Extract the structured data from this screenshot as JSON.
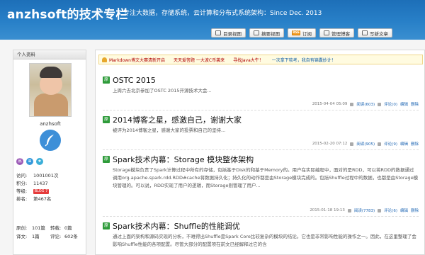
{
  "header": {
    "title": "anzhsoft的技术专栏",
    "subtitle": "专注大数据，存储系统，云计算和分布式系统架构：Since Dec. 2013"
  },
  "toolbar": {
    "buttons": [
      {
        "label": "目录视图",
        "icon": "list-icon"
      },
      {
        "label": "摘要视图",
        "icon": "summary-icon"
      },
      {
        "label": "订阅",
        "icon": "rss-icon",
        "badge": "RSS"
      },
      {
        "label": "管理博客",
        "icon": "manage-icon"
      },
      {
        "label": "写新文章",
        "icon": "write-icon"
      }
    ]
  },
  "sidebar": {
    "heading": "个人资料",
    "username": "anzhsoft",
    "badges": [
      {
        "color": "#9b59b6",
        "label": "三"
      },
      {
        "color": "#3498db",
        "label": "≡"
      },
      {
        "color": "#3aaed8",
        "label": "★"
      }
    ],
    "stats": {
      "visits_label": "访问:",
      "visits": "1001001次",
      "points_label": "积分:",
      "points": "11437",
      "level_label": "等级:",
      "level": "BLOG 7",
      "rank_label": "排名:",
      "rank": "第467名",
      "original_label": "原创:",
      "original": "101篇",
      "reprint_label": "转载:",
      "reprint": "0篇",
      "translated_label": "译文:",
      "translated": "1篇",
      "comments_label": "评论:",
      "comments": "602条"
    }
  },
  "notice": {
    "items": [
      "Markdown博文大赛清新开启",
      "天天爱答题 一大波C币袭来",
      "寻找Java大牛！",
      "一次拿下软考，我自有锦囊妙计！"
    ]
  },
  "posts": [
    {
      "badge": "原",
      "title": "OSTC 2015",
      "summary": "上周六去北京参加了OSTC 2015开源技术大会...",
      "date": "2015-04-04 05:09",
      "reads": "阅读(603)",
      "comments": "评论(0)",
      "edit": "编辑",
      "delete": "删除"
    },
    {
      "badge": "原",
      "title": "2014博客之星，感激自己，谢谢大家",
      "summary": "被评为2014博客之星，感谢大家的投票和自己的坚持...",
      "date": "2015-02-20 07:12",
      "reads": "阅读(905)",
      "comments": "评论(9)",
      "edit": "编辑",
      "delete": "删除"
    },
    {
      "badge": "原",
      "title": "Spark技术内幕：Storage 模块整体架构",
      "summary": "Storage模块负责了Spark计算过程中所有的存储，包括基于Disk的和基于Memory的。用户在实际编程中，面对的是RDD，可以将RDD的数据通过调用org.apache.spark.rdd.RDD#cache将数据持久化；持久化的动作都是由Storage模块完成的。包括Shuffle过程中的数据，也都是由Storage模块管理的。可以说，RDD实现了用户的逻辑，而Storage则管理了用户...",
      "date": "2015-01-18 19:13",
      "reads": "阅读(7783)",
      "comments": "评论(6)",
      "edit": "编辑",
      "delete": "删除"
    },
    {
      "badge": "原",
      "title": "Spark技术内幕：Shuffle的性能调优",
      "summary": "通过上面的架构和源码实现的分析，不难得出Shuffle是Spark Core比较复杂的模块的结论。它也是非常影响性能的操作之一。因此，在这里整理了会影响Shuffle性能的各项配置。尽管大部分的配置项在前文已经解释过它的含"
    }
  ]
}
